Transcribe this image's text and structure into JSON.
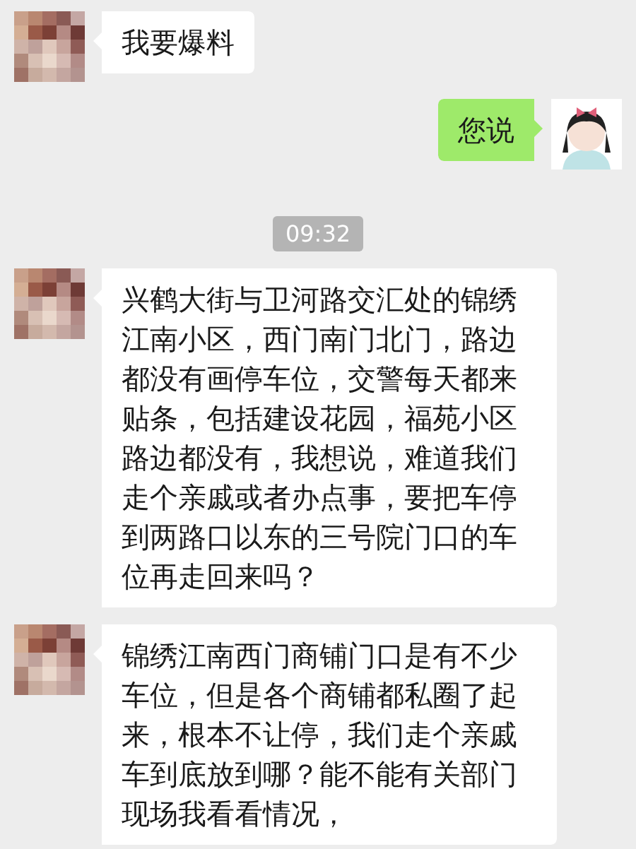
{
  "messages": [
    {
      "kind": "text",
      "outgoing": false,
      "text": "我要爆料"
    },
    {
      "kind": "text",
      "outgoing": true,
      "text": "您说"
    },
    {
      "kind": "time",
      "text": "09:32"
    },
    {
      "kind": "text",
      "outgoing": false,
      "text": "兴鹤大街与卫河路交汇处的锦绣江南小区，西门南门北门，路边都没有画停车位，交警每天都来贴条，包括建设花园，福苑小区路边都没有，我想说，难道我们走个亲戚或者办点事，要把车停到两路口以东的三号院门口的车位再走回来吗？"
    },
    {
      "kind": "text",
      "outgoing": false,
      "text": "锦绣江南西门商铺门口是有不少车位，但是各个商铺都私圈了起来，根本不让停，我们走个亲戚车到底放到哪？能不能有关部门现场我看看情况，"
    }
  ]
}
